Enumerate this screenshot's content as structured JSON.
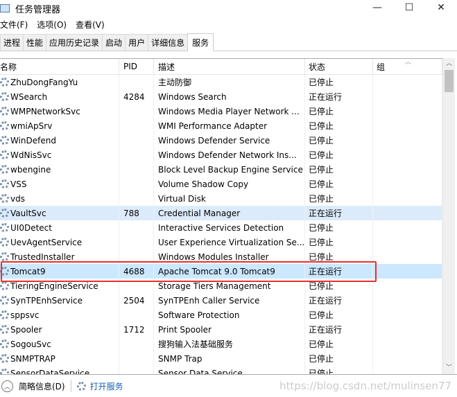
{
  "window": {
    "title": "任务管理器",
    "minimize": "—",
    "maximize": "☐",
    "close": "✕"
  },
  "menu": [
    "文件(F)",
    "选项(O)",
    "查看(V)"
  ],
  "tabs": [
    "进程",
    "性能",
    "应用历史记录",
    "启动",
    "用户",
    "详细信息",
    "服务"
  ],
  "active_tab": "服务",
  "columns": [
    "名称",
    "PID",
    "描述",
    "状态",
    "组"
  ],
  "rows": [
    [
      "ZhuDongFangYu",
      "",
      "主动防御",
      "已停止"
    ],
    [
      "WSearch",
      "4284",
      "Windows Search",
      "正在运行"
    ],
    [
      "WMPNetworkSvc",
      "",
      "Windows Media Player Network ...",
      "已停止"
    ],
    [
      "wmiApSrv",
      "",
      "WMI Performance Adapter",
      "已停止"
    ],
    [
      "WinDefend",
      "",
      "Windows Defender Service",
      "已停止"
    ],
    [
      "WdNisSvc",
      "",
      "Windows Defender Network Ins...",
      "已停止"
    ],
    [
      "wbengine",
      "",
      "Block Level Backup Engine Service",
      "已停止"
    ],
    [
      "VSS",
      "",
      "Volume Shadow Copy",
      "已停止"
    ],
    [
      "vds",
      "",
      "Virtual Disk",
      "已停止"
    ],
    [
      "VaultSvc",
      "788",
      "Credential Manager",
      "正在运行"
    ],
    [
      "UI0Detect",
      "",
      "Interactive Services Detection",
      "已停止"
    ],
    [
      "UevAgentService",
      "",
      "User Experience Virtualization Se...",
      "已停止"
    ],
    [
      "TrustedInstaller",
      "",
      "Windows Modules Installer",
      "已停止"
    ],
    [
      "Tomcat9",
      "4688",
      "Apache Tomcat 9.0 Tomcat9",
      "正在运行"
    ],
    [
      "TieringEngineService",
      "",
      "Storage Tiers Management",
      "已停止"
    ],
    [
      "SynTPEnhService",
      "2504",
      "SynTPEnh Caller Service",
      "正在运行"
    ],
    [
      "sppsvc",
      "",
      "Software Protection",
      "已停止"
    ],
    [
      "Spooler",
      "1712",
      "Print Spooler",
      "正在运行"
    ],
    [
      "SogouSvc",
      "",
      "搜狗输入法基础服务",
      "已停止"
    ],
    [
      "SNMPTRAP",
      "",
      "SNMP Trap",
      "已停止"
    ],
    [
      "SensorDataService",
      "",
      "Sensor Data Service",
      "已停止"
    ]
  ],
  "selected_row": "Tomcat9",
  "footer": {
    "details": "简略信息(D)",
    "open_services": "打开服务"
  },
  "watermark": "https://blog.csdn.net/mulinsen77",
  "colors": {
    "selection": "#cce8ff",
    "highlight_box": "#e8302a",
    "link": "#1a5fb4"
  }
}
